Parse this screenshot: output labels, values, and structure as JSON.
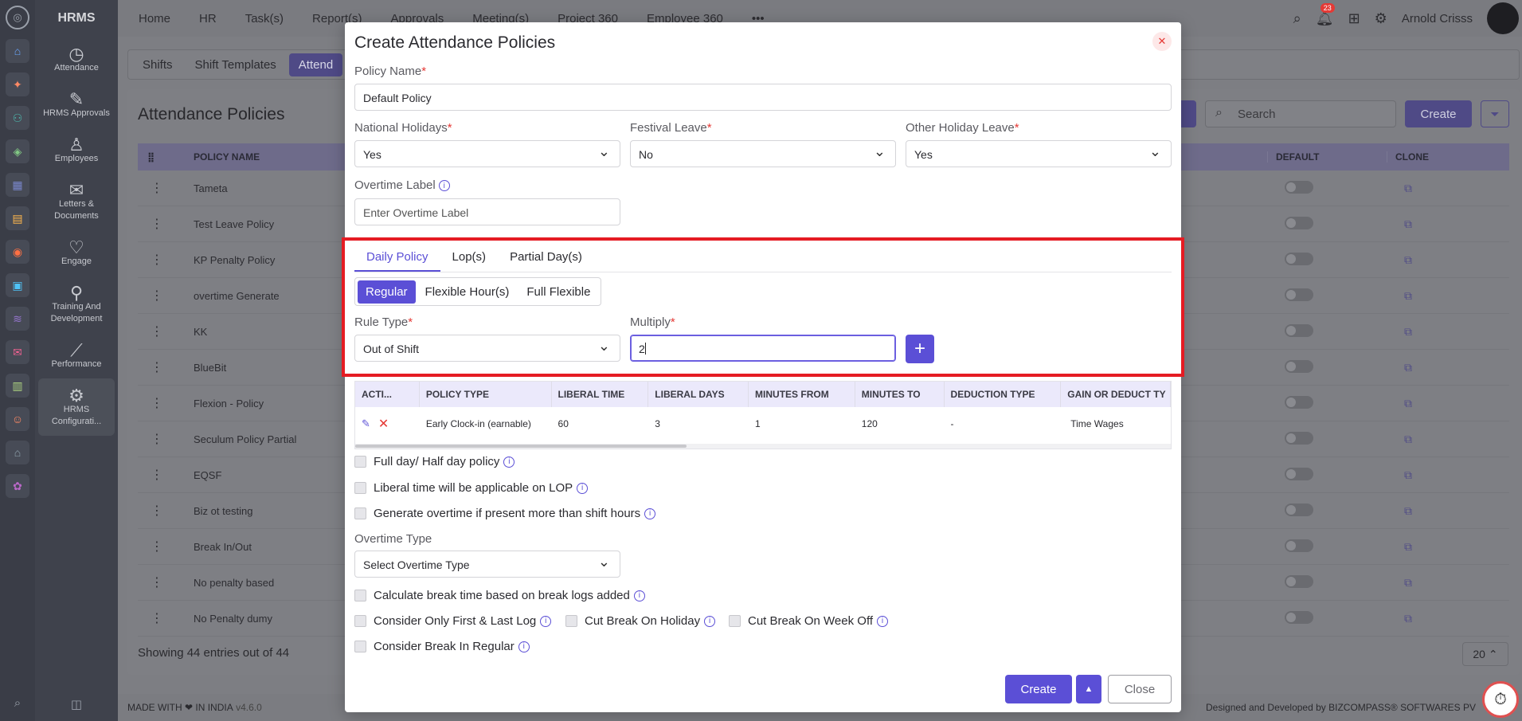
{
  "app": {
    "brand": "HRMS"
  },
  "sidebar": {
    "items": [
      {
        "label": "Attendance",
        "icon": "attendance-icon"
      },
      {
        "label": "HRMS Approvals",
        "icon": "approvals-icon"
      },
      {
        "label": "Employees",
        "icon": "employees-icon"
      },
      {
        "label": "Letters & Documents",
        "icon": "documents-icon"
      },
      {
        "label": "Engage",
        "icon": "engage-icon"
      },
      {
        "label": "Training And Development",
        "icon": "training-icon"
      },
      {
        "label": "Performance",
        "icon": "performance-icon"
      },
      {
        "label": "HRMS Configurati...",
        "icon": "gear-icon"
      }
    ]
  },
  "topnav": {
    "items": [
      "Home",
      "HR",
      "Task(s)",
      "Report(s)",
      "Approvals",
      "Meeting(s)",
      "Project 360",
      "Employee 360"
    ]
  },
  "topbar": {
    "notifications": "23",
    "user": "Arnold Crisss"
  },
  "subtabs": [
    "Shifts",
    "Shift Templates",
    "Attend"
  ],
  "background": {
    "title": "Attendance Policies",
    "search_placeholder": "Search",
    "create_label": "Create",
    "columns": {
      "policy_name": "POLICY NAME",
      "default": "DEFAULT",
      "clone": "CLONE"
    },
    "rows": [
      "Tameta",
      "Test Leave Policy",
      "KP Penalty Policy",
      "overtime Generate",
      "KK",
      "BlueBit",
      "Flexion - Policy",
      "Seculum Policy Partial",
      "EQSF",
      "Biz ot testing",
      "Break In/Out",
      "No penalty based",
      "No Penalty dumy"
    ],
    "footer_entries": "Showing 44 entries out of 44",
    "page_size": "20"
  },
  "footer": {
    "left": "MADE WITH ❤ IN INDIA",
    "version": "v4.6.0",
    "right": "Designed and Developed by BIZCOMPASS® SOFTWARES PV"
  },
  "modal": {
    "title": "Create Attendance Policies",
    "policy_name": {
      "label": "Policy Name",
      "value": "Default Policy"
    },
    "national_holidays": {
      "label": "National Holidays",
      "value": "Yes"
    },
    "festival_leave": {
      "label": "Festival Leave",
      "value": "No"
    },
    "other_holiday_leave": {
      "label": "Other Holiday Leave",
      "value": "Yes"
    },
    "overtime_label": {
      "label": "Overtime Label",
      "placeholder": "Enter Overtime Label"
    },
    "tabs": [
      "Daily Policy",
      "Lop(s)",
      "Partial Day(s)"
    ],
    "segments": [
      "Regular",
      "Flexible Hour(s)",
      "Full Flexible"
    ],
    "rule_type": {
      "label": "Rule Type",
      "value": "Out of Shift"
    },
    "multiply": {
      "label": "Multiply",
      "value": "2"
    },
    "table": {
      "headers": [
        "ACTI...",
        "POLICY TYPE",
        "LIBERAL TIME",
        "LIBERAL DAYS",
        "MINUTES FROM",
        "MINUTES TO",
        "DEDUCTION TYPE",
        "GAIN OR DEDUCT TY"
      ],
      "row": [
        "Early Clock-in (earnable)",
        "60",
        "3",
        "1",
        "120",
        "-",
        "Time Wages"
      ]
    },
    "checks": {
      "full_half": "Full day/ Half day policy",
      "liberal_lop": "Liberal time will be applicable on LOP",
      "generate_ot": "Generate overtime if present more than shift hours",
      "calc_break": "Calculate break time based on break logs added",
      "first_last": "Consider Only First & Last Log",
      "cut_holiday": "Cut Break On Holiday",
      "cut_weekoff": "Cut Break On Week Off",
      "break_regular": "Consider Break In Regular"
    },
    "overtime_type": {
      "label": "Overtime Type",
      "value": "Select Overtime Type"
    },
    "buttons": {
      "create": "Create",
      "close": "Close"
    }
  }
}
